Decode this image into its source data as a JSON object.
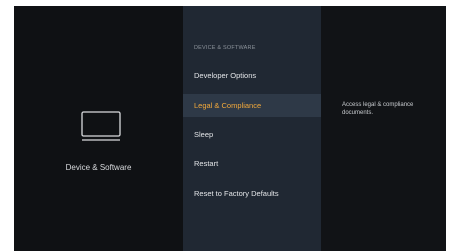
{
  "left": {
    "label": "Device & Software",
    "icon": "tv-icon"
  },
  "menu": {
    "heading": "DEVICE & SOFTWARE",
    "items": [
      {
        "label": "Developer Options",
        "selected": false
      },
      {
        "label": "Legal & Compliance",
        "selected": true
      },
      {
        "label": "Sleep",
        "selected": false
      },
      {
        "label": "Restart",
        "selected": false
      },
      {
        "label": "Reset to Factory Defaults",
        "selected": false
      }
    ]
  },
  "description": {
    "text": "Access legal & compliance documents."
  },
  "colors": {
    "background": "#111316",
    "menu_panel": "#202833",
    "selected_row": "#2e3947",
    "accent": "#f2a93b"
  }
}
